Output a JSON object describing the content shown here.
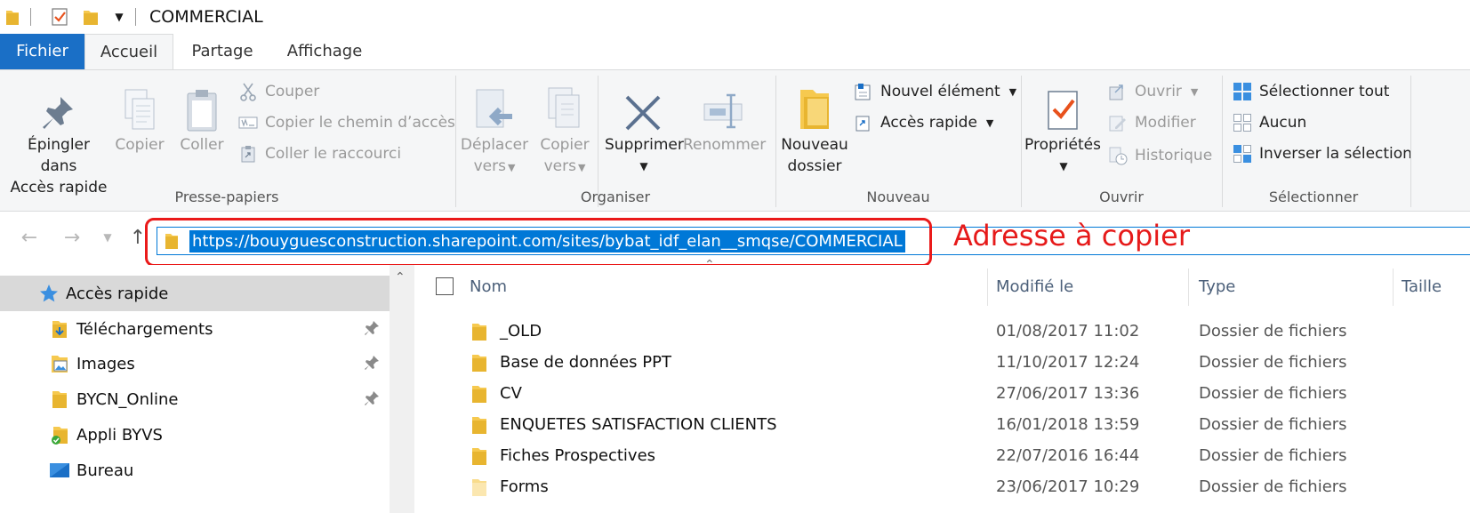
{
  "window": {
    "title": "COMMERCIAL"
  },
  "tabs": {
    "file": "Fichier",
    "home": "Accueil",
    "share": "Partage",
    "view": "Affichage"
  },
  "ribbon": {
    "clipboard": {
      "label": "Presse-papiers",
      "pin_line1": "Épingler dans",
      "pin_line2": "Accès rapide",
      "copy": "Copier",
      "paste": "Coller",
      "cut": "Couper",
      "copy_path": "Copier le chemin d’accès",
      "paste_shortcut": "Coller le raccourci"
    },
    "organize": {
      "label": "Organiser",
      "move_line1": "Déplacer",
      "move_line2": "vers",
      "copyto_line1": "Copier",
      "copyto_line2": "vers",
      "delete": "Supprimer",
      "rename": "Renommer"
    },
    "new": {
      "label": "Nouveau",
      "folder_line1": "Nouveau",
      "folder_line2": "dossier",
      "new_item": "Nouvel élément",
      "easy_access": "Accès rapide"
    },
    "open": {
      "label": "Ouvrir",
      "properties": "Propriétés",
      "open": "Ouvrir",
      "edit": "Modifier",
      "history": "Historique"
    },
    "select": {
      "label": "Sélectionner",
      "select_all": "Sélectionner tout",
      "select_none": "Aucun",
      "invert": "Inverser la sélection"
    }
  },
  "address": {
    "url": "https://bouyguesconstruction.sharepoint.com/sites/bybat_idf_elan__smqse/COMMERCIAL",
    "annotation": "Adresse à copier"
  },
  "navpane": {
    "quick_access": "Accès rapide",
    "items": [
      {
        "label": "Téléchargements",
        "icon": "download-folder-icon",
        "pinned": true
      },
      {
        "label": "Images",
        "icon": "pictures-folder-icon",
        "pinned": true
      },
      {
        "label": "BYCN_Online",
        "icon": "folder-icon",
        "pinned": true
      },
      {
        "label": "Appli BYVS",
        "icon": "synced-folder-icon",
        "pinned": false
      },
      {
        "label": "Bureau",
        "icon": "desktop-icon",
        "pinned": false
      }
    ]
  },
  "filelist": {
    "columns": {
      "name": "Nom",
      "modified": "Modifié le",
      "type": "Type",
      "size": "Taille"
    },
    "rows": [
      {
        "name": "_OLD",
        "modified": "01/08/2017 11:02",
        "type": "Dossier de fichiers"
      },
      {
        "name": "Base de données PPT",
        "modified": "11/10/2017 12:24",
        "type": "Dossier de fichiers"
      },
      {
        "name": "CV",
        "modified": "27/06/2017 13:36",
        "type": "Dossier de fichiers"
      },
      {
        "name": "ENQUETES SATISFACTION CLIENTS",
        "modified": "16/01/2018 13:59",
        "type": "Dossier de fichiers"
      },
      {
        "name": "Fiches Prospectives",
        "modified": "22/07/2016 16:44",
        "type": "Dossier de fichiers"
      },
      {
        "name": "Forms",
        "modified": "23/06/2017 10:29",
        "type": "Dossier de fichiers"
      }
    ]
  },
  "colors": {
    "accent": "#1a6fc6",
    "selection": "#0078d7",
    "annotation": "#e61a1a",
    "folder": "#f6c94f"
  }
}
